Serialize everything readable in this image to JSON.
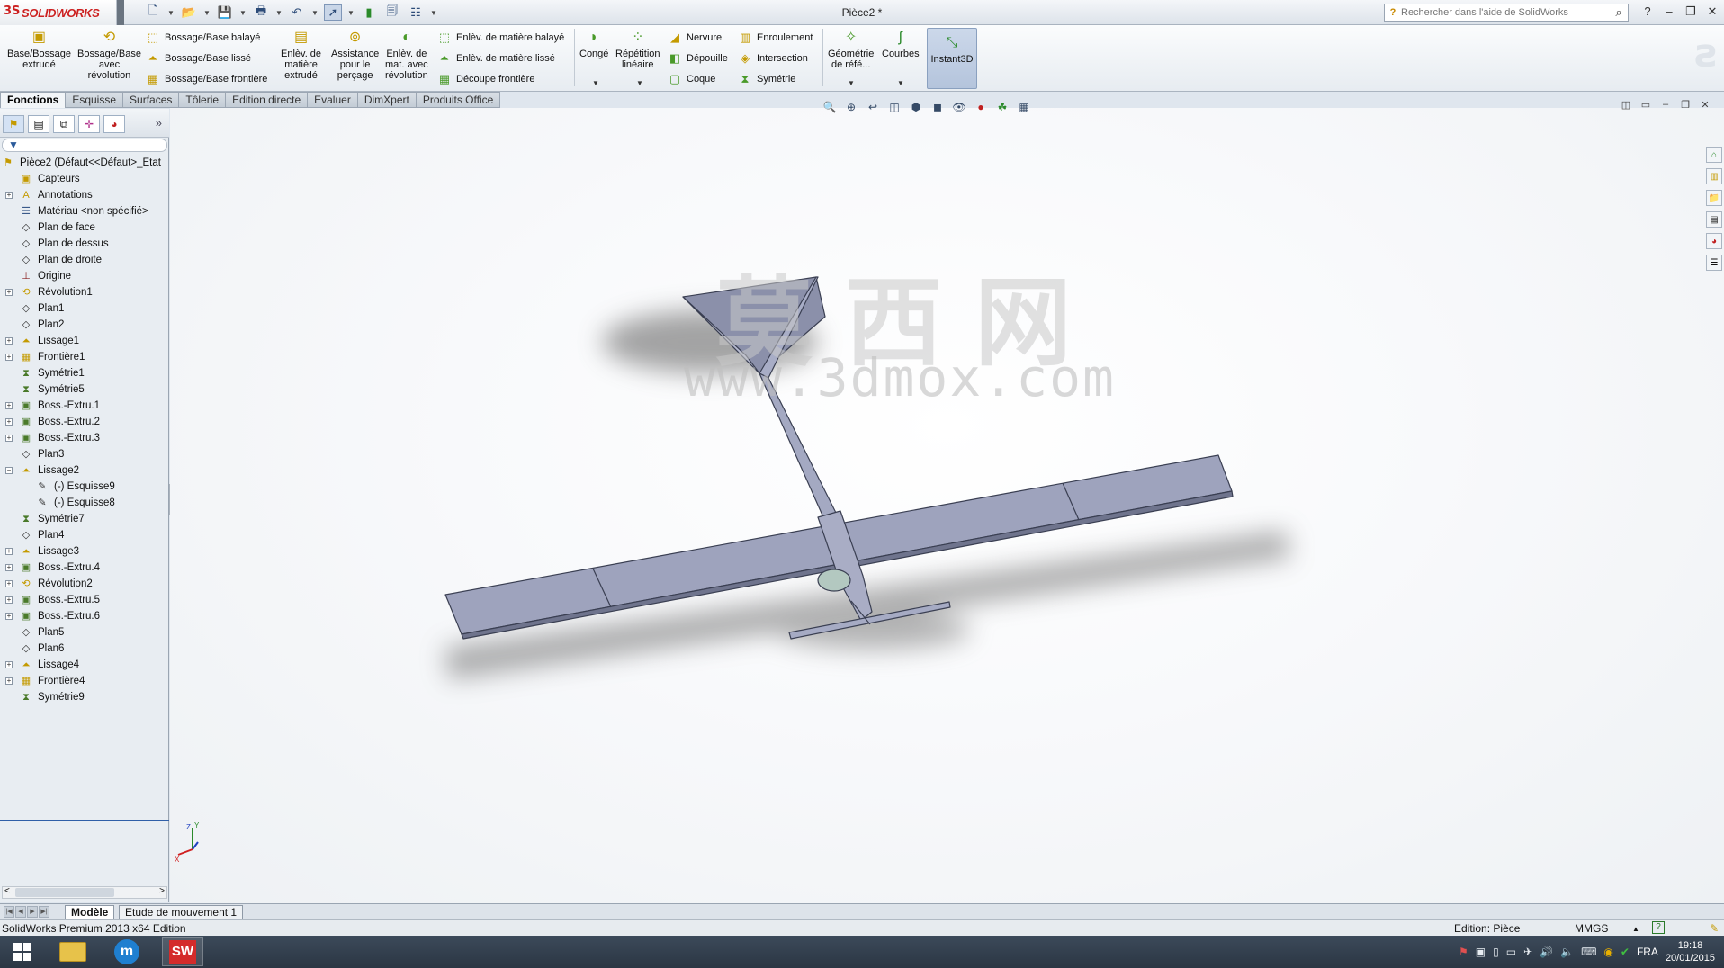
{
  "app": {
    "logo_text": "SOLIDWORKS",
    "document_title": "Pièce2 *",
    "search_placeholder": "Rechercher dans l'aide de SolidWorks"
  },
  "ribbon": {
    "big_buttons": [
      {
        "label": "Base/Bossage\nextrudé",
        "icon": "extrude-boss-icon"
      },
      {
        "label": "Bossage/Base\navec\nrévolution",
        "icon": "revolve-boss-icon"
      },
      {
        "label": "Enlèv. de\nmatière\nextrudé",
        "icon": "extruded-cut-icon"
      },
      {
        "label": "Assistance\npour le\nperçage",
        "icon": "hole-wizard-icon"
      },
      {
        "label": "Enlèv. de\nmat. avec\nrévolution",
        "icon": "revolved-cut-icon"
      },
      {
        "label": "Congé",
        "icon": "fillet-icon"
      },
      {
        "label": "Répétition\nlinéaire",
        "icon": "linear-pattern-icon"
      },
      {
        "label": "Géométrie\nde réfé...",
        "icon": "reference-geometry-icon"
      },
      {
        "label": "Courbes",
        "icon": "curves-icon"
      },
      {
        "label": "Instant3D",
        "icon": "instant3d-icon"
      }
    ],
    "boss_column": [
      "Bossage/Base balayé",
      "Bossage/Base lissé",
      "Bossage/Base frontière"
    ],
    "cut_column": [
      "Enlèv. de matière balayé",
      "Enlèv. de matière lissé",
      "Découpe frontière"
    ],
    "feature_column": [
      "Nervure",
      "Dépouille",
      "Coque"
    ],
    "feature_column2": [
      "Enroulement",
      "Intersection",
      "Symétrie"
    ]
  },
  "tabs": [
    "Fonctions",
    "Esquisse",
    "Surfaces",
    "Tôlerie",
    "Edition directe",
    "Evaluer",
    "DimXpert",
    "Produits Office"
  ],
  "tree": {
    "root": "Pièce2  (Défaut<<Défaut>_Etat",
    "items": [
      {
        "label": "Capteurs",
        "icon": "sensor-icon",
        "exp": false,
        "indent": 0
      },
      {
        "label": "Annotations",
        "icon": "annotations-icon",
        "exp": true,
        "indent": 0
      },
      {
        "label": "Matériau <non spécifié>",
        "icon": "material-icon",
        "exp": false,
        "indent": 0
      },
      {
        "label": "Plan de face",
        "icon": "plane-icon",
        "exp": false,
        "indent": 0
      },
      {
        "label": "Plan de dessus",
        "icon": "plane-icon",
        "exp": false,
        "indent": 0
      },
      {
        "label": "Plan de droite",
        "icon": "plane-icon",
        "exp": false,
        "indent": 0
      },
      {
        "label": "Origine",
        "icon": "origin-icon",
        "exp": false,
        "indent": 0
      },
      {
        "label": "Révolution1",
        "icon": "revolve-feature-icon",
        "exp": true,
        "indent": 0
      },
      {
        "label": "Plan1",
        "icon": "plane-icon",
        "exp": false,
        "indent": 0
      },
      {
        "label": "Plan2",
        "icon": "plane-icon",
        "exp": false,
        "indent": 0
      },
      {
        "label": "Lissage1",
        "icon": "loft-feature-icon",
        "exp": true,
        "indent": 0
      },
      {
        "label": "Frontière1",
        "icon": "boundary-feature-icon",
        "exp": true,
        "indent": 0
      },
      {
        "label": "Symétrie1",
        "icon": "mirror-feature-icon",
        "exp": false,
        "indent": 0
      },
      {
        "label": "Symétrie5",
        "icon": "mirror-feature-icon",
        "exp": false,
        "indent": 0
      },
      {
        "label": "Boss.-Extru.1",
        "icon": "extrude-feature-icon",
        "exp": true,
        "indent": 0
      },
      {
        "label": "Boss.-Extru.2",
        "icon": "extrude-feature-icon",
        "exp": true,
        "indent": 0
      },
      {
        "label": "Boss.-Extru.3",
        "icon": "extrude-feature-icon",
        "exp": true,
        "indent": 0
      },
      {
        "label": "Plan3",
        "icon": "plane-icon",
        "exp": false,
        "indent": 0
      },
      {
        "label": "Lissage2",
        "icon": "loft-feature-icon",
        "exp": true,
        "indent": 0,
        "open": true
      },
      {
        "label": "(-) Esquisse9",
        "icon": "sketch-icon",
        "exp": false,
        "indent": 1
      },
      {
        "label": "(-) Esquisse8",
        "icon": "sketch-icon",
        "exp": false,
        "indent": 1
      },
      {
        "label": "Symétrie7",
        "icon": "mirror-feature-icon",
        "exp": false,
        "indent": 0
      },
      {
        "label": "Plan4",
        "icon": "plane-icon",
        "exp": false,
        "indent": 0
      },
      {
        "label": "Lissage3",
        "icon": "loft-feature-icon",
        "exp": true,
        "indent": 0
      },
      {
        "label": "Boss.-Extru.4",
        "icon": "extrude-feature-icon",
        "exp": true,
        "indent": 0
      },
      {
        "label": "Révolution2",
        "icon": "revolve-feature-icon",
        "exp": true,
        "indent": 0
      },
      {
        "label": "Boss.-Extru.5",
        "icon": "extrude-feature-icon",
        "exp": true,
        "indent": 0
      },
      {
        "label": "Boss.-Extru.6",
        "icon": "extrude-feature-icon",
        "exp": true,
        "indent": 0
      },
      {
        "label": "Plan5",
        "icon": "plane-icon",
        "exp": false,
        "indent": 0
      },
      {
        "label": "Plan6",
        "icon": "plane-icon",
        "exp": false,
        "indent": 0
      },
      {
        "label": "Lissage4",
        "icon": "loft-feature-icon",
        "exp": true,
        "indent": 0
      },
      {
        "label": "Frontière4",
        "icon": "boundary-feature-icon",
        "exp": true,
        "indent": 0
      },
      {
        "label": "Symétrie9",
        "icon": "mirror-feature-icon",
        "exp": false,
        "indent": 0
      }
    ]
  },
  "watermark": {
    "cn": "莫西网",
    "url": "www.3dmox.com"
  },
  "triad": {
    "x": "X",
    "y": "Y",
    "z": "Z"
  },
  "model_tabs": [
    "Modèle",
    "Etude de mouvement 1"
  ],
  "status": {
    "edition": "SolidWorks Premium 2013 x64 Edition",
    "mode": "Edition: Pièce",
    "units": "MMGS",
    "help": "?"
  },
  "taskbar": {
    "lang": "FRA",
    "time": "19:18",
    "date": "20/01/2015"
  },
  "colors": {
    "accent": "#2f5fa8",
    "model_face": "#9ea3bd",
    "model_edge": "#3a3f52"
  }
}
